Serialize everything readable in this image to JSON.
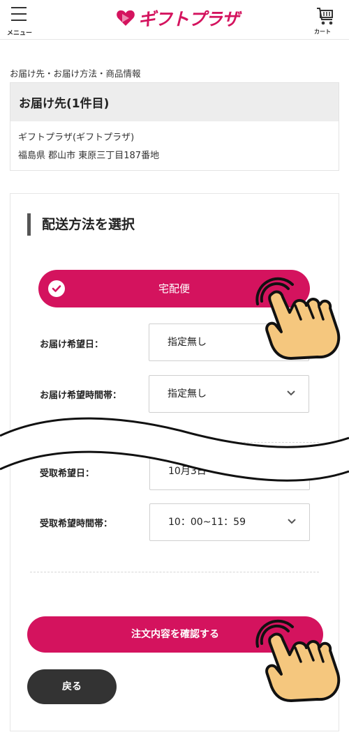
{
  "header": {
    "menu_label": "メニュー",
    "logo_text": "ギフトプラザ",
    "cart_label": "カート"
  },
  "breadcrumb": "お届け先・お届け方法・商品情報",
  "delivery": {
    "title": "お届け先(1件目)",
    "recipient": "ギフトプラザ(ギフトプラザ)",
    "address": "福島県 郡山市 東原三丁目187番地"
  },
  "shipping": {
    "section_title": "配送方法を選択",
    "method_label": "宅配便",
    "fields": [
      {
        "label": "お届け希望日：",
        "value": "指定無し"
      },
      {
        "label": "お届け希望時間帯：",
        "value": "指定無し"
      },
      {
        "label": "受取希望日：",
        "value": "10月3日"
      },
      {
        "label": "受取希望時間帯：",
        "value": "10：00~11：59"
      }
    ]
  },
  "actions": {
    "confirm_label": "注文内容を確認する",
    "back_label": "戻る"
  },
  "colors": {
    "accent": "#d4135e",
    "dark_button": "#333333",
    "hand": "#f5c77e"
  }
}
